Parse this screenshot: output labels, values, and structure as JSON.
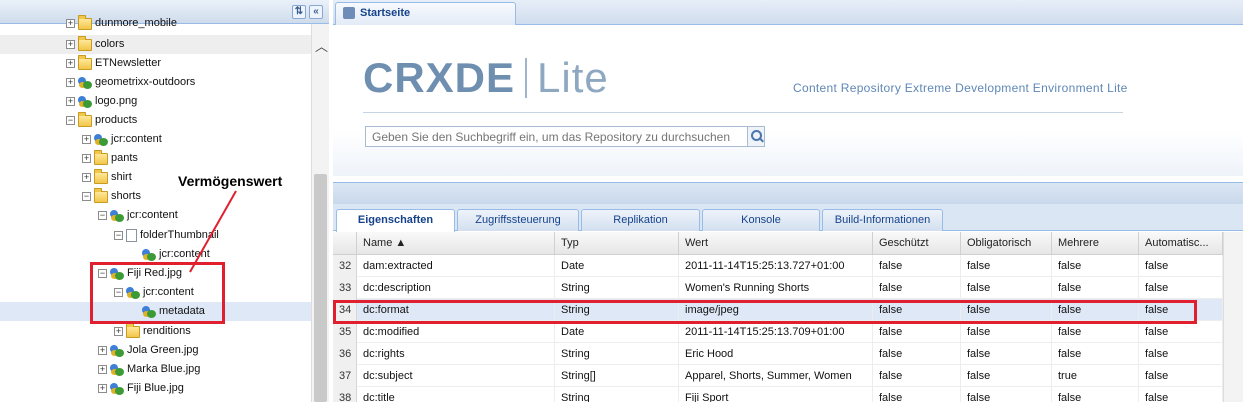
{
  "tree": {
    "header_buttons": [
      "⇅",
      "«"
    ],
    "items": [
      {
        "label": "dunmore_mobile",
        "icon": "folder-icon",
        "exp": "+"
      },
      {
        "label": "colors",
        "icon": "folder-icon",
        "exp": "+"
      },
      {
        "label": "ETNewsletter",
        "icon": "folder-icon",
        "exp": "+"
      },
      {
        "label": "geometrixx-outdoors",
        "icon": "node-icon",
        "exp": "+"
      },
      {
        "label": "logo.png",
        "icon": "node-icon",
        "exp": "+"
      },
      {
        "label": "products",
        "icon": "folder-icon",
        "exp": "−"
      },
      {
        "label": "jcr:content",
        "icon": "node-icon",
        "exp": "+"
      },
      {
        "label": "pants",
        "icon": "folder-icon",
        "exp": "+"
      },
      {
        "label": "shirt",
        "icon": "folder-icon",
        "exp": "+"
      },
      {
        "label": "shorts",
        "icon": "folder-icon",
        "exp": "−"
      },
      {
        "label": "jcr:content",
        "icon": "node-icon",
        "exp": "−"
      },
      {
        "label": "folderThumbnail",
        "icon": "file-icon",
        "exp": "−"
      },
      {
        "label": "jcr:content",
        "icon": "node-icon",
        "exp": ""
      },
      {
        "label": "Fiji Red.jpg",
        "icon": "node-icon",
        "exp": "−"
      },
      {
        "label": "jcr:content",
        "icon": "node-icon",
        "exp": "−"
      },
      {
        "label": "metadata",
        "icon": "node-icon",
        "exp": ""
      },
      {
        "label": "renditions",
        "icon": "folder-icon",
        "exp": "+"
      },
      {
        "label": "Jola Green.jpg",
        "icon": "node-icon",
        "exp": "+"
      },
      {
        "label": "Marka Blue.jpg",
        "icon": "node-icon",
        "exp": "+"
      },
      {
        "label": "Fiji Blue.jpg",
        "icon": "node-icon",
        "exp": "+"
      }
    ]
  },
  "annotation": {
    "label": "Vermögenswert",
    "color": "#e0202e"
  },
  "main": {
    "start_tab": "Startseite",
    "logo": {
      "part1": "CRXDE",
      "part2": "Lite"
    },
    "subtitle": "Content Repository Extreme Development Environment Lite",
    "search_placeholder": "Geben Sie den Suchbegriff ein, um das Repository zu durchsuchen",
    "tabs": [
      "Eigenschaften",
      "Zugriffssteuerung",
      "Replikation",
      "Konsole",
      "Build-Informationen"
    ],
    "columns": [
      "",
      "Name ▲",
      "Typ",
      "Wert",
      "Geschützt",
      "Obligatorisch",
      "Mehrere",
      "Automatisc..."
    ],
    "rows": [
      [
        "32",
        "dam:extracted",
        "Date",
        "2011-11-14T15:25:13.727+01:00",
        "false",
        "false",
        "false",
        "false"
      ],
      [
        "33",
        "dc:description",
        "String",
        "Women's Running Shorts",
        "false",
        "false",
        "false",
        "false"
      ],
      [
        "34",
        "dc:format",
        "String",
        "image/jpeg",
        "false",
        "false",
        "false",
        "false"
      ],
      [
        "35",
        "dc:modified",
        "Date",
        "2011-11-14T15:25:13.709+01:00",
        "false",
        "false",
        "false",
        "false"
      ],
      [
        "36",
        "dc:rights",
        "String",
        "Eric Hood",
        "false",
        "false",
        "false",
        "false"
      ],
      [
        "37",
        "dc:subject",
        "String[]",
        "Apparel, Shorts, Summer, Women",
        "false",
        "false",
        "true",
        "false"
      ],
      [
        "38",
        "dc:title",
        "String",
        "Fiji Sport",
        "false",
        "false",
        "false",
        "false"
      ]
    ]
  }
}
